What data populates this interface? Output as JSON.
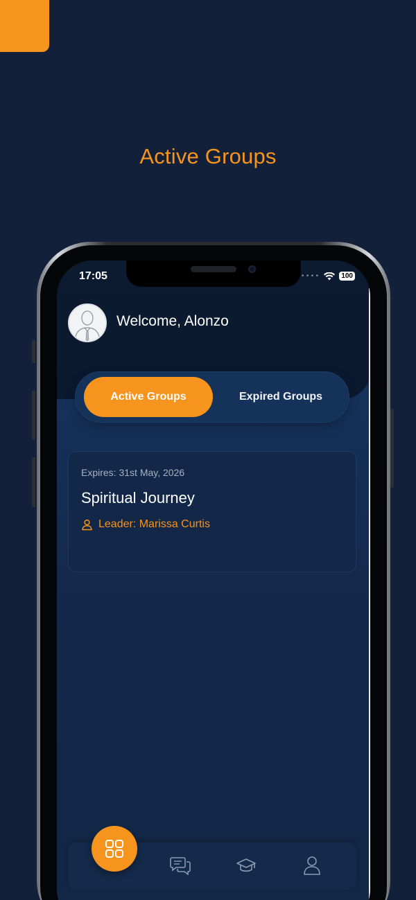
{
  "page_heading": "Active Groups",
  "colors": {
    "accent": "#f7941d",
    "background": "#13203a",
    "screen": "#142a4a"
  },
  "status_bar": {
    "time": "17:05",
    "battery": "100",
    "wifi_icon": "wifi-icon"
  },
  "header": {
    "welcome": "Welcome, Alonzo",
    "avatar_icon": "user-avatar-icon"
  },
  "tabs": {
    "active_label": "Active Groups",
    "inactive_label": "Expired Groups"
  },
  "group_card": {
    "expires": "Expires: 31st May, 2026",
    "title": "Spiritual Journey",
    "leader": "Leader: Marissa Curtis",
    "leader_icon": "person-icon"
  },
  "bottom_nav": {
    "items": [
      "grid-icon",
      "chat-icon",
      "graduation-cap-icon",
      "profile-icon"
    ]
  }
}
